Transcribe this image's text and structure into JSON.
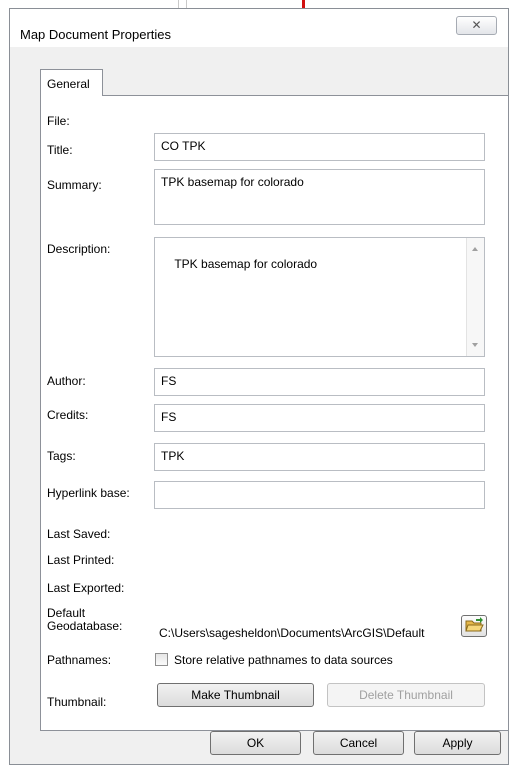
{
  "dialog": {
    "title": "Map Document Properties",
    "close_label": "X",
    "tabs": [
      {
        "label": "General"
      }
    ]
  },
  "fields": {
    "file": {
      "label": "File:",
      "value": ""
    },
    "title": {
      "label": "Title:",
      "value": "CO TPK"
    },
    "summary": {
      "label": "Summary:",
      "value": "TPK basemap for colorado"
    },
    "description": {
      "label": "Description:",
      "value": "TPK basemap for colorado"
    },
    "author": {
      "label": "Author:",
      "value": "FS"
    },
    "credits": {
      "label": "Credits:",
      "value": "FS"
    },
    "tags": {
      "label": "Tags:",
      "value": "TPK"
    },
    "hyperlink_base": {
      "label": "Hyperlink base:",
      "value": ""
    },
    "last_saved": {
      "label": "Last Saved:",
      "value": ""
    },
    "last_printed": {
      "label": "Last Printed:",
      "value": ""
    },
    "last_exported": {
      "label": "Last Exported:",
      "value": ""
    },
    "default_gdb": {
      "label_line1": "Default",
      "label_line2": "Geodatabase:",
      "value": "C:\\Users\\sagesheldon\\Documents\\ArcGIS\\Default",
      "browse_icon": "folder-open-icon"
    },
    "pathnames": {
      "label": "Pathnames:",
      "checkbox_label": "Store relative pathnames to data sources",
      "checked": false
    },
    "thumbnail": {
      "label": "Thumbnail:",
      "make_label": "Make Thumbnail",
      "delete_label": "Delete Thumbnail"
    }
  },
  "footer": {
    "ok": "OK",
    "cancel": "Cancel",
    "apply": "Apply"
  },
  "colors": {
    "window_bg": "#f0f0f0",
    "panel_bg": "#ffffff",
    "border": "#8d9199"
  }
}
